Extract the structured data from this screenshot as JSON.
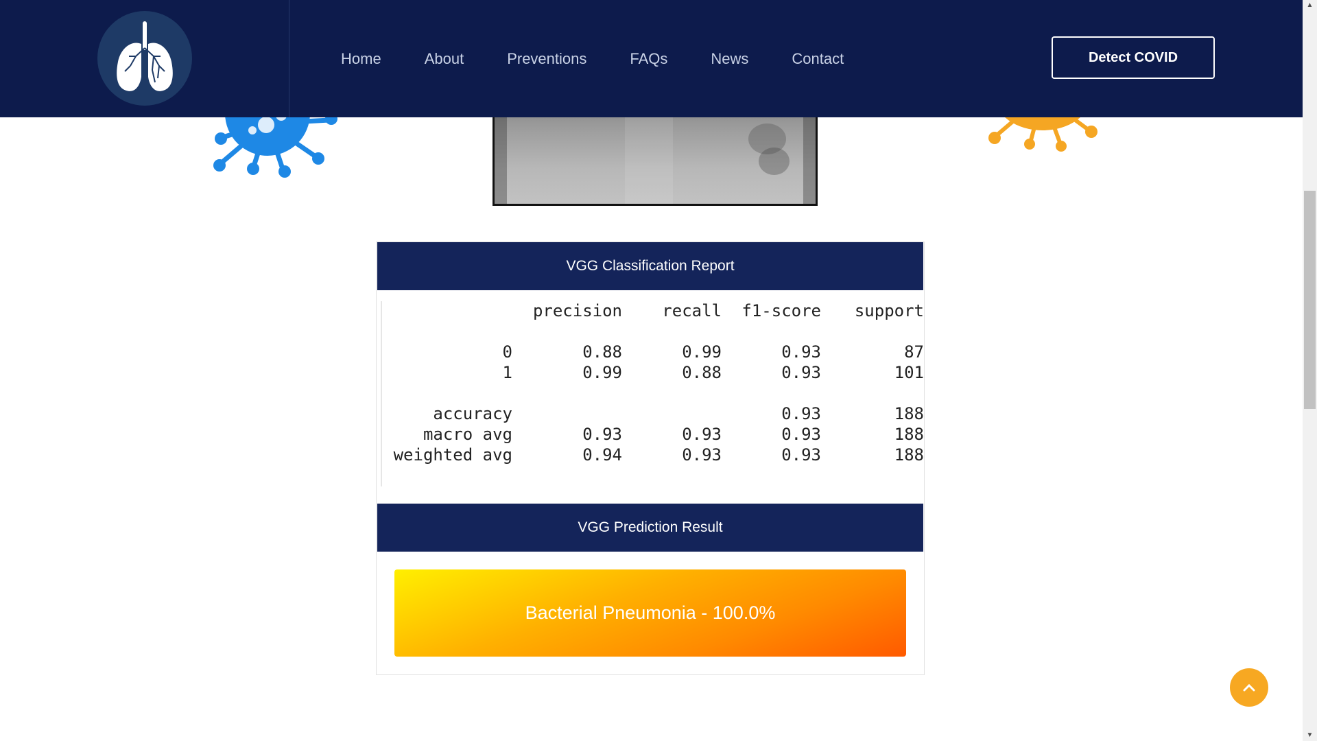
{
  "nav": {
    "logo_icon": "lungs-icon",
    "links": [
      "Home",
      "About",
      "Preventions",
      "FAQs",
      "News",
      "Contact"
    ],
    "cta_label": "Detect COVID"
  },
  "colors": {
    "navbar_bg": "#0d1b4c",
    "card_header_bg": "#14245a",
    "accent_orange": "#f7a822",
    "virus_blue": "#1e88e5",
    "virus_orange": "#f5a623"
  },
  "report": {
    "title": "VGG Classification Report",
    "headers": [
      "",
      "precision",
      "recall",
      "f1-score",
      "support"
    ],
    "rows": [
      [
        "0",
        "0.88",
        "0.99",
        "0.93",
        "87"
      ],
      [
        "1",
        "0.99",
        "0.88",
        "0.93",
        "101"
      ],
      [
        "accuracy",
        "",
        "",
        "0.93",
        "188"
      ],
      [
        "macro avg",
        "0.93",
        "0.93",
        "0.93",
        "188"
      ],
      [
        "weighted avg",
        "0.94",
        "0.93",
        "0.93",
        "188"
      ]
    ]
  },
  "prediction": {
    "title": "VGG Prediction Result",
    "result_text": "Bacterial Pneumonia - 100.0%"
  }
}
